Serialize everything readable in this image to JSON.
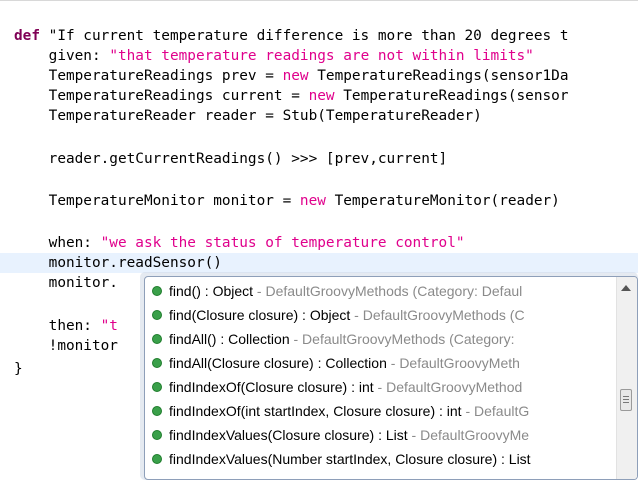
{
  "editor": {
    "lines": [
      {
        "segments": [
          {
            "t": "def ",
            "c": "kw"
          },
          {
            "t": "\"If current temperature difference is more than 20 degrees t",
            "c": ""
          }
        ]
      },
      {
        "segments": [
          {
            "t": "    given: ",
            "c": ""
          },
          {
            "t": "\"that temperature readings are not within limits\"",
            "c": "mag"
          }
        ]
      },
      {
        "segments": [
          {
            "t": "    TemperatureReadings prev = ",
            "c": ""
          },
          {
            "t": "new",
            "c": "mag"
          },
          {
            "t": " TemperatureReadings(sensor1Da",
            "c": ""
          }
        ]
      },
      {
        "segments": [
          {
            "t": "    TemperatureReadings current = ",
            "c": ""
          },
          {
            "t": "new",
            "c": "mag"
          },
          {
            "t": " TemperatureReadings(sensor",
            "c": ""
          }
        ]
      },
      {
        "segments": [
          {
            "t": "    TemperatureReader reader = Stub(TemperatureReader)",
            "c": ""
          }
        ]
      },
      {
        "segments": [
          {
            "t": "",
            "c": ""
          }
        ]
      },
      {
        "segments": [
          {
            "t": "    reader.getCurrentReadings() >>> [prev,current]",
            "c": ""
          }
        ]
      },
      {
        "segments": [
          {
            "t": "",
            "c": ""
          }
        ]
      },
      {
        "segments": [
          {
            "t": "    TemperatureMonitor monitor = ",
            "c": ""
          },
          {
            "t": "new",
            "c": "mag"
          },
          {
            "t": " TemperatureMonitor(reader)",
            "c": ""
          }
        ]
      },
      {
        "segments": [
          {
            "t": "",
            "c": ""
          }
        ]
      },
      {
        "segments": [
          {
            "t": "    when: ",
            "c": ""
          },
          {
            "t": "\"we ask the status of temperature control\"",
            "c": "mag"
          }
        ]
      },
      {
        "segments": [
          {
            "t": "    monitor.readSensor()",
            "c": ""
          }
        ]
      },
      {
        "segments": [
          {
            "t": "    monitor.",
            "c": ""
          }
        ]
      },
      {
        "segments": [
          {
            "t": "",
            "c": ""
          }
        ]
      },
      {
        "segments": [
          {
            "t": "    then: ",
            "c": ""
          },
          {
            "t": "\"t",
            "c": "mag"
          }
        ]
      },
      {
        "segments": [
          {
            "t": "    !monitor",
            "c": ""
          }
        ]
      },
      {
        "segments": [
          {
            "t": "}",
            "c": ""
          }
        ]
      }
    ]
  },
  "content_assist": {
    "items": [
      {
        "signature": "find() : Object",
        "source": " - DefaultGroovyMethods (Category: Defaul",
        "icon": "public-method-icon"
      },
      {
        "signature": "find(Closure closure) : Object",
        "source": " - DefaultGroovyMethods (C",
        "icon": "public-method-icon"
      },
      {
        "signature": "findAll() : Collection",
        "source": " - DefaultGroovyMethods (Category:",
        "icon": "public-method-icon"
      },
      {
        "signature": "findAll(Closure closure) : Collection",
        "source": " - DefaultGroovyMeth",
        "icon": "public-method-icon"
      },
      {
        "signature": "findIndexOf(Closure closure) : int",
        "source": " - DefaultGroovyMethod",
        "icon": "public-method-icon"
      },
      {
        "signature": "findIndexOf(int startIndex, Closure closure) : int",
        "source": " - DefaultG",
        "icon": "public-method-icon"
      },
      {
        "signature": "findIndexValues(Closure closure) : List",
        "source": " - DefaultGroovyMe",
        "icon": "public-method-icon"
      },
      {
        "signature": "findIndexValues(Number startIndex, Closure closure) : List",
        "source": "",
        "icon": "public-method-icon"
      }
    ]
  },
  "colors": {
    "keyword": "#7f0055",
    "string": "#e0008c",
    "current_line": "#e8f2fe",
    "method_icon": "#3aa04a"
  }
}
